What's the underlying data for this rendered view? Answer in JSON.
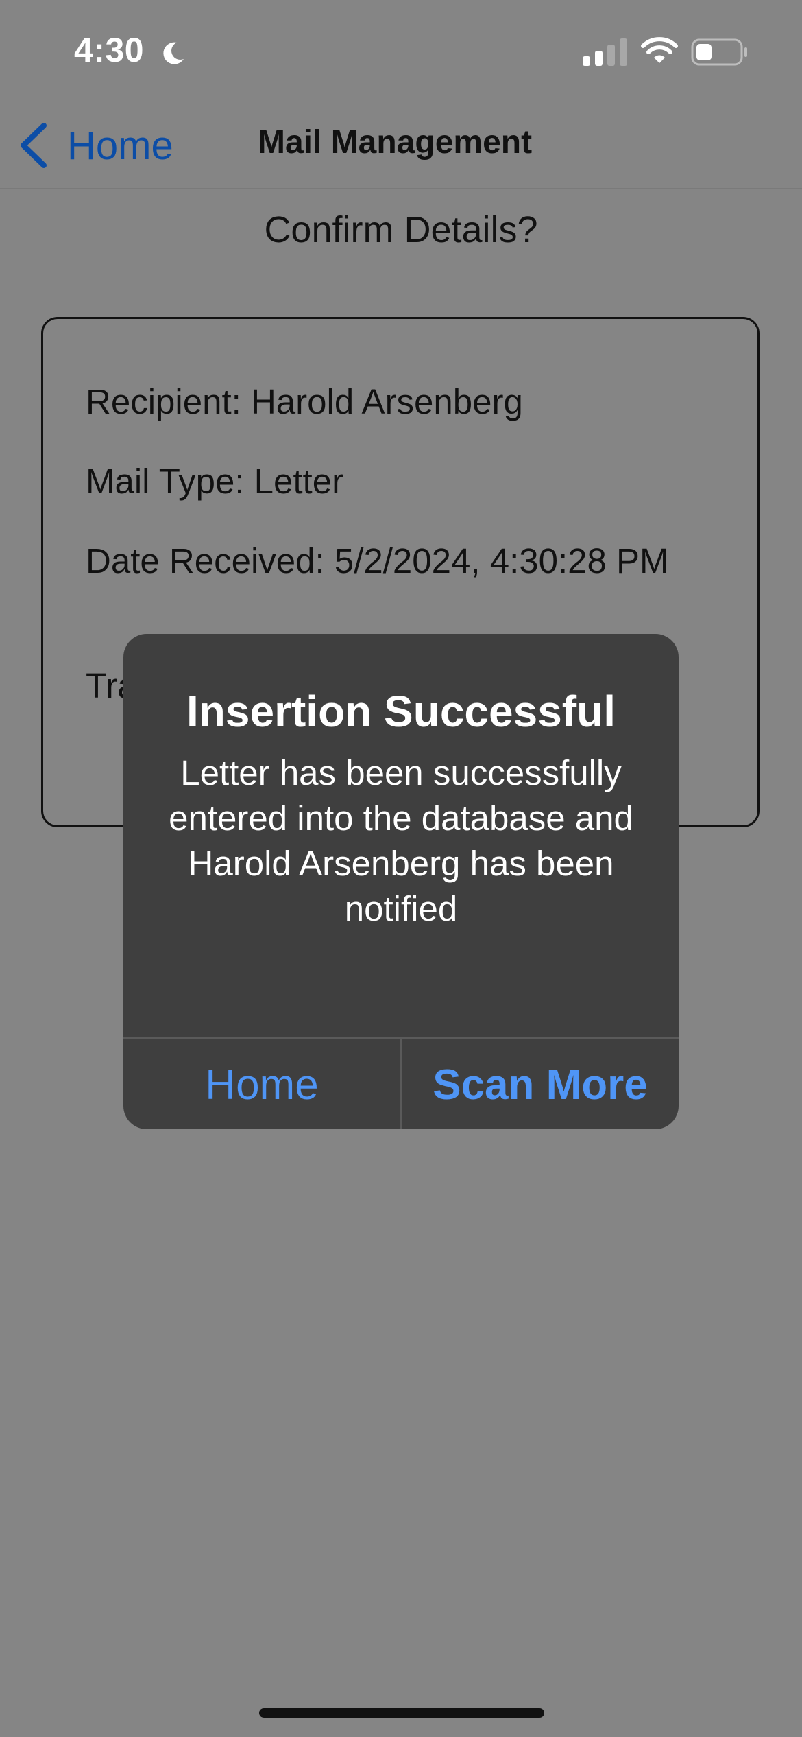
{
  "status_bar": {
    "time": "4:30",
    "focus_icon": "moon-icon",
    "signal_icon": "cellular-signal-icon",
    "wifi_icon": "wifi-icon",
    "battery_icon": "battery-icon"
  },
  "nav": {
    "back_label": "Home",
    "title": "Mail Management"
  },
  "page": {
    "heading": "Confirm Details?"
  },
  "details": {
    "recipient": "Recipient: Harold Arsenberg",
    "mail_type": "Mail Type: Letter",
    "date_received": "Date Received: 5/2/2024, 4:30:28 PM",
    "tracking_partial": "Tra"
  },
  "alert": {
    "title": "Insertion Successful",
    "message": "Letter has been successfully entered into the database and Harold Arsenberg has been notified",
    "buttons": {
      "home": "Home",
      "scan_more": "Scan More"
    }
  },
  "colors": {
    "dimmed_background": "#858585",
    "accent": "#0c4da6",
    "alert_background": "#3f3f3f",
    "alert_button": "#4f95f6"
  }
}
